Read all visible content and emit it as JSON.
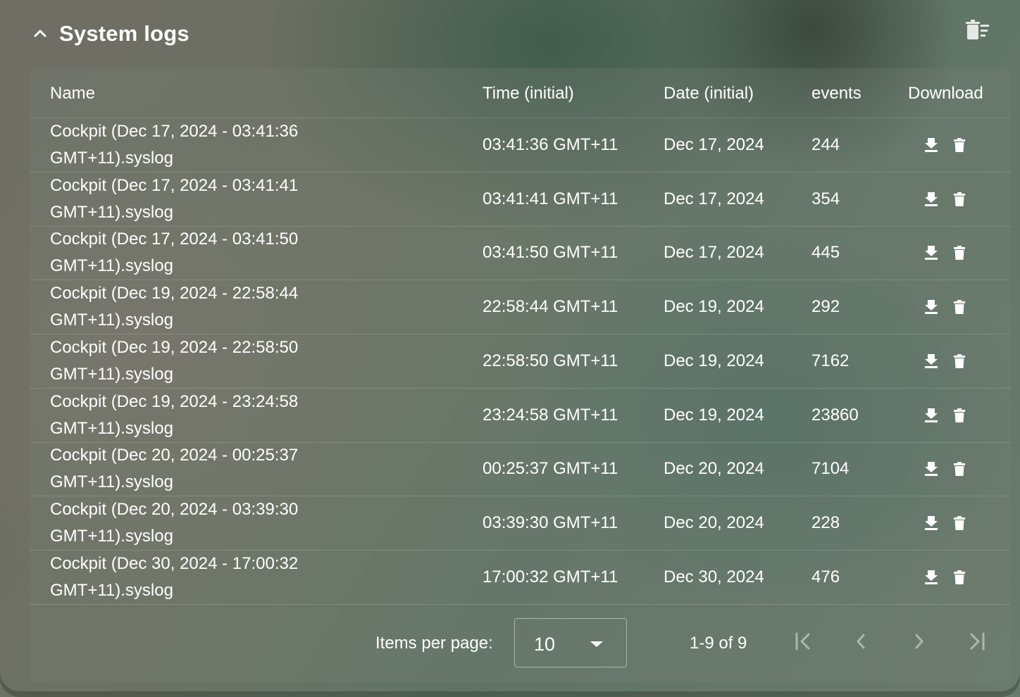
{
  "panel": {
    "title": "System logs",
    "collapse_icon": "chevron-up-icon",
    "clear_all_icon": "delete-sweep-icon"
  },
  "table": {
    "columns": {
      "name": "Name",
      "time": "Time (initial)",
      "date": "Date (initial)",
      "events": "events",
      "download": "Download"
    },
    "rows": [
      {
        "name_line1": "Cockpit (Dec 17, 2024 - 03:41:36",
        "name_line2": "GMT+11).syslog",
        "time": "03:41:36 GMT+11",
        "date": "Dec 17, 2024",
        "events": "244"
      },
      {
        "name_line1": "Cockpit (Dec 17, 2024 - 03:41:41",
        "name_line2": "GMT+11).syslog",
        "time": "03:41:41 GMT+11",
        "date": "Dec 17, 2024",
        "events": "354"
      },
      {
        "name_line1": "Cockpit (Dec 17, 2024 - 03:41:50",
        "name_line2": "GMT+11).syslog",
        "time": "03:41:50 GMT+11",
        "date": "Dec 17, 2024",
        "events": "445"
      },
      {
        "name_line1": "Cockpit (Dec 19, 2024 - 22:58:44",
        "name_line2": "GMT+11).syslog",
        "time": "22:58:44 GMT+11",
        "date": "Dec 19, 2024",
        "events": "292"
      },
      {
        "name_line1": "Cockpit (Dec 19, 2024 - 22:58:50",
        "name_line2": "GMT+11).syslog",
        "time": "22:58:50 GMT+11",
        "date": "Dec 19, 2024",
        "events": "7162"
      },
      {
        "name_line1": "Cockpit (Dec 19, 2024 - 23:24:58",
        "name_line2": "GMT+11).syslog",
        "time": "23:24:58 GMT+11",
        "date": "Dec 19, 2024",
        "events": "23860"
      },
      {
        "name_line1": "Cockpit (Dec 20, 2024 - 00:25:37",
        "name_line2": "GMT+11).syslog",
        "time": "00:25:37 GMT+11",
        "date": "Dec 20, 2024",
        "events": "7104"
      },
      {
        "name_line1": "Cockpit (Dec 20, 2024 - 03:39:30",
        "name_line2": "GMT+11).syslog",
        "time": "03:39:30 GMT+11",
        "date": "Dec 20, 2024",
        "events": "228"
      },
      {
        "name_line1": "Cockpit (Dec 30, 2024 - 17:00:32",
        "name_line2": "GMT+11).syslog",
        "time": "17:00:32 GMT+11",
        "date": "Dec 30, 2024",
        "events": "476"
      }
    ],
    "row_actions": {
      "download_icon": "download-icon",
      "delete_icon": "trash-icon"
    }
  },
  "pagination": {
    "items_per_page_label": "Items per page:",
    "items_per_page_value": "10",
    "range_label": "1-9 of 9",
    "first_icon": "first-page-icon",
    "prev_icon": "chevron-left-icon",
    "next_icon": "chevron-right-icon",
    "last_icon": "last-page-icon"
  }
}
